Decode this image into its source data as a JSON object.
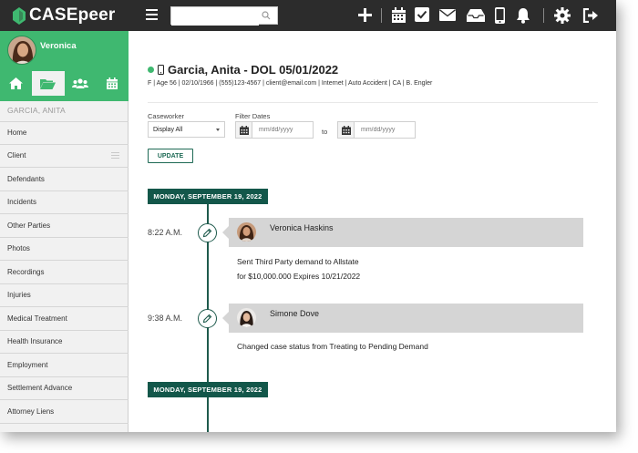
{
  "app": {
    "logo_text": "CASEpeer",
    "brand_color": "#3fb870",
    "dark_green": "#13574a"
  },
  "topbar": {
    "search_placeholder": "",
    "icons": [
      "plus-icon",
      "calendar-icon",
      "checkbox-icon",
      "mail-icon",
      "inbox-icon",
      "mobile-icon",
      "bell-icon",
      "gear-icon",
      "logout-icon"
    ]
  },
  "sidebar": {
    "user_name": "Veronica",
    "nav_tabs": [
      "home-icon",
      "folder-icon",
      "users-icon",
      "calendar-icon"
    ],
    "active_tab": "folder-icon",
    "client_label": "GARCIA, ANITA",
    "items": [
      {
        "label": "Home"
      },
      {
        "label": "Client"
      },
      {
        "label": "Defendants"
      },
      {
        "label": "Incidents"
      },
      {
        "label": "Other Parties"
      },
      {
        "label": "Photos"
      },
      {
        "label": "Recordings"
      },
      {
        "label": "Injuries"
      },
      {
        "label": "Medical Treatment"
      },
      {
        "label": "Health Insurance"
      },
      {
        "label": "Employment"
      },
      {
        "label": "Settlement Advance"
      },
      {
        "label": "Attorney Liens"
      }
    ]
  },
  "case": {
    "title": "Garcia, Anita - DOL 05/01/2022",
    "meta": "F | Age 56 | 02/10/1966 | (555)123-4567 | client@email.com | Internet | Auto Accident | CA | B. Engler"
  },
  "filters": {
    "caseworker_label": "Caseworker",
    "caseworker_value": "Display All",
    "filter_dates_label": "Filter Dates",
    "date_placeholder": "mm/dd/yyyy",
    "to_label": "to",
    "update_label": "UPDATE"
  },
  "timeline": {
    "groups": [
      {
        "date": "MONDAY, SEPTEMBER 19, 2022",
        "events": [
          {
            "time": "8:22 A.M.",
            "author": "Veronica Haskins",
            "lines": [
              "Sent Third Party demand to Allstate",
              "for $10,000.000 Expires 10/21/2022"
            ]
          },
          {
            "time": "9:38 A.M.",
            "author": "Simone Dove",
            "lines": [
              "Changed case status from Treating to Pending Demand"
            ]
          }
        ]
      },
      {
        "date": "MONDAY, SEPTEMBER 19, 2022",
        "events": []
      }
    ]
  }
}
